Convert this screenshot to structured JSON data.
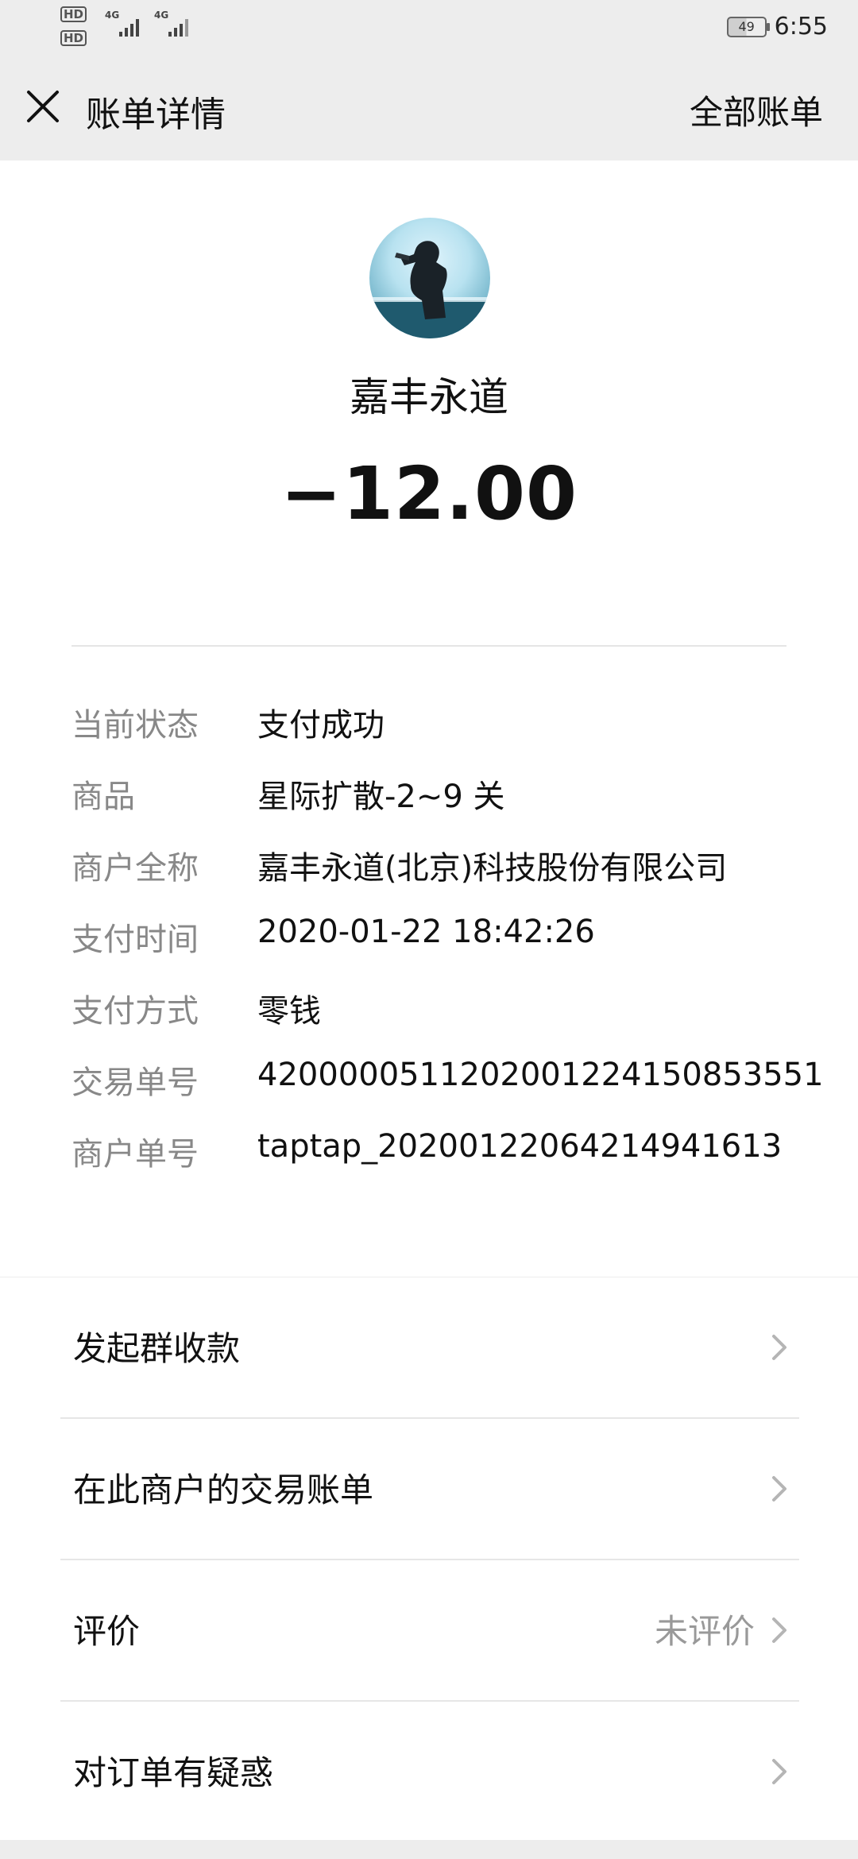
{
  "status_bar": {
    "time": "6:55",
    "battery": "49",
    "hd1": "HD",
    "hd2": "HD",
    "net1": "4G",
    "net2": "4G"
  },
  "header": {
    "title": "账单详情",
    "right_link": "全部账单"
  },
  "summary": {
    "merchant": "嘉丰永道",
    "amount": "−12.00"
  },
  "details": [
    {
      "label": "当前状态",
      "value": "支付成功"
    },
    {
      "label": "商品",
      "value": "星际扩散-2~9 关"
    },
    {
      "label": "商户全称",
      "value": "嘉丰永道(北京)科技股份有限公司"
    },
    {
      "label": "支付时间",
      "value": "2020-01-22 18:42:26"
    },
    {
      "label": "支付方式",
      "value": "零钱"
    },
    {
      "label": "交易单号",
      "value": "4200000511202001224150853551"
    },
    {
      "label": "商户单号",
      "value": "taptap_20200122064214941613"
    }
  ],
  "actions": [
    {
      "label": "发起群收款",
      "value": ""
    },
    {
      "label": "在此商户的交易账单",
      "value": ""
    },
    {
      "label": "评价",
      "value": "未评价"
    },
    {
      "label": "对订单有疑惑",
      "value": ""
    }
  ]
}
